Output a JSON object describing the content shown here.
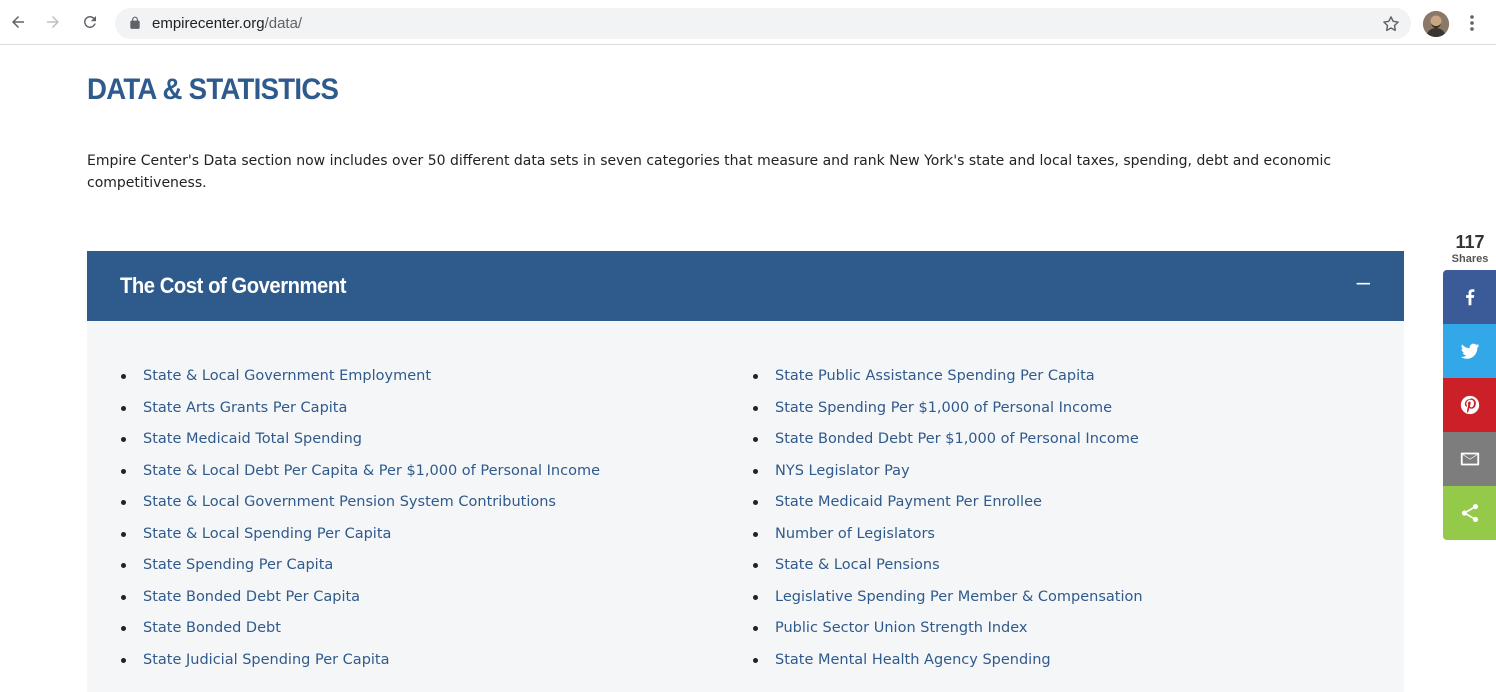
{
  "browser": {
    "url_domain": "empirecenter.org",
    "url_path": "/data/",
    "icons": [
      "back-arrow-icon",
      "forward-arrow-icon",
      "reload-icon",
      "lock-icon",
      "star-icon",
      "profile-avatar",
      "menu-dots-icon"
    ]
  },
  "page": {
    "title": "DATA & STATISTICS",
    "intro": "Empire Center's Data section now includes over 50 different data sets in seven categories that measure and rank New York's state and local taxes, spending, debt and economic competitiveness."
  },
  "accordion": {
    "title": "The Cost of Government",
    "toggle": "–",
    "left_items": [
      "State & Local Government Employment",
      "State Arts Grants Per Capita",
      "State Medicaid Total Spending",
      "State & Local Debt Per Capita & Per $1,000 of Personal Income",
      "State & Local Government Pension System Contributions",
      "State & Local Spending Per Capita",
      "State Spending Per Capita",
      "State Bonded Debt Per Capita",
      "State Bonded Debt",
      "State Judicial Spending Per Capita"
    ],
    "right_items": [
      "State Public Assistance Spending Per Capita",
      "State Spending Per $1,000 of Personal Income",
      "State Bonded Debt Per $1,000 of Personal Income",
      "NYS Legislator Pay",
      "State Medicaid Payment Per Enrollee",
      "Number of Legislators",
      "State & Local Pensions",
      "Legislative Spending Per Member & Compensation",
      "Public Sector Union Strength Index",
      "State Mental Health Agency Spending"
    ]
  },
  "share": {
    "count": "117",
    "label": "Shares",
    "colors": {
      "facebook": "#3a5a98",
      "twitter": "#33a8e8",
      "pinterest": "#cb2027",
      "email": "#7d7d7d",
      "share": "#95c94a"
    }
  },
  "colors": {
    "brand_blue": "#2f5a8c",
    "panel_bg": "#f5f6f8"
  }
}
